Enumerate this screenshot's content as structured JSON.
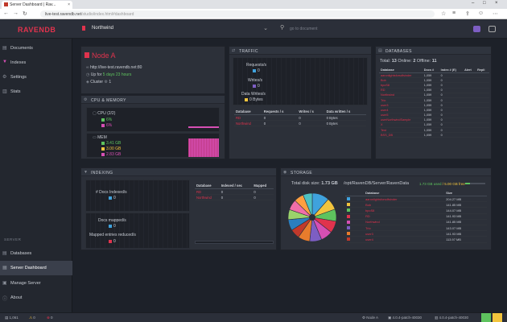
{
  "browser": {
    "tab_title": "Server Dashboard | Rav...",
    "url_host": "live-test.ravendb.net",
    "url_path": "/studio/index.html#dashboard"
  },
  "header": {
    "logo_prefix": "RAVEN",
    "logo_suffix": "DB",
    "database": "Northwind",
    "search_placeholder": "go to document"
  },
  "sidebar": {
    "items": [
      {
        "label": "Documents",
        "icon": "documents-icon"
      },
      {
        "label": "Indexes",
        "icon": "indexes-icon"
      },
      {
        "label": "Settings",
        "icon": "settings-icon"
      },
      {
        "label": "Stats",
        "icon": "stats-icon"
      }
    ],
    "server_label": "SERVER",
    "server_items": [
      {
        "label": "Databases",
        "icon": "databases-icon"
      },
      {
        "label": "Server Dashboard",
        "icon": "dashboard-icon"
      },
      {
        "label": "Manage Server",
        "icon": "manage-server-icon"
      },
      {
        "label": "About",
        "icon": "about-icon"
      }
    ]
  },
  "node": {
    "title": "Node A",
    "url": "http://live-test.ravendb.net:80",
    "uptime_label": "Up for",
    "uptime": "5 days 23 hours",
    "cluster_label": "Cluster",
    "cluster_count": "1"
  },
  "cpu_memory": {
    "title": "CPU & MEMORY",
    "cpu_label": "CPU",
    "cpu_cores": "(2/2)",
    "cpu_total": "6%",
    "cpu_ravendb": "6%",
    "mem_label": "MEM",
    "mem_total": "3.41 GB",
    "mem_used": "3.00 GB",
    "mem_ravendb": "2.83 GB"
  },
  "traffic": {
    "title": "TRAFFIC",
    "requests_label": "Requests/s",
    "requests_value": "0",
    "writes_label": "Writes/s",
    "writes_value": "0",
    "data_writes_label": "Data Writes/s",
    "data_writes_value": "0 Bytes",
    "columns": [
      "Database",
      "Requests / s",
      "Writes / s",
      "Data written / s"
    ],
    "rows": [
      [
        "RD",
        "0",
        "0",
        "0 Bytes"
      ],
      [
        "Northwind",
        "0",
        "0",
        "0 Bytes"
      ]
    ]
  },
  "databases": {
    "title": "DATABASES",
    "total_label": "Total:",
    "total": "13",
    "online_label": "Online:",
    "online": "2",
    "offline_label": "Offline:",
    "offline": "11",
    "columns": [
      "Database",
      "Docs #",
      "Index # (E)",
      "Alert",
      "Repli"
    ],
    "rows": [
      [
        "aaronlightsforsdfsinder",
        "1,059",
        "0",
        "",
        ""
      ],
      [
        "Bob",
        "1,059",
        "0",
        "",
        ""
      ],
      [
        "bpoS8",
        "1,059",
        "0",
        "",
        ""
      ],
      [
        "RD",
        "1,059",
        "0",
        "",
        ""
      ],
      [
        "Northwind",
        "1,059",
        "0",
        "",
        ""
      ],
      [
        "Trio",
        "1,059",
        "0",
        "",
        ""
      ],
      [
        "user3",
        "1,059",
        "0",
        "",
        ""
      ],
      [
        "user4",
        "1,059",
        "0",
        "",
        ""
      ],
      [
        "user5",
        "1,059",
        "0",
        "",
        ""
      ],
      [
        "userNorthwindSample",
        "1,059",
        "0",
        "",
        ""
      ],
      [
        "X",
        "1,059",
        "0",
        "",
        ""
      ],
      [
        "Test",
        "1,059",
        "0",
        "",
        ""
      ],
      [
        "BSS_DB",
        "1,059",
        "0",
        "",
        ""
      ]
    ]
  },
  "indexing": {
    "title": "INDEXING",
    "docs_indexed_label": "# Docs Indexed/s",
    "docs_indexed": "0",
    "docs_mapped_label": "Docs mapped/s",
    "docs_mapped": "0",
    "mapped_reduced_label": "Mapped entries reduced/s",
    "mapped_reduced": "0",
    "columns": [
      "Database",
      "Indexed / sec",
      "Mapped"
    ],
    "rows": [
      [
        "RD",
        "0",
        "0"
      ],
      [
        "Northwind",
        "0",
        "0"
      ]
    ]
  },
  "storage": {
    "title": "STORAGE",
    "total_label": "Total disk size:",
    "total": "1.73 GB",
    "path": "/opt/RavenDB/Server/RavenData",
    "used": "1.73 GB used",
    "free": "/ 5.00 GB free",
    "columns": [
      "Database",
      "Size"
    ],
    "rows": [
      {
        "name": "aaronlightsforsdfsinder",
        "size": "204.27 MB",
        "color": "#3fa2dd"
      },
      {
        "name": "Bob",
        "size": "141.85 MB",
        "color": "#f2c43d"
      },
      {
        "name": "bpoS8",
        "size": "144.07 MB",
        "color": "#5ec35e"
      },
      {
        "name": "RD",
        "size": "141.93 MB",
        "color": "#e0334d"
      },
      {
        "name": "Northwind",
        "size": "141.85 MB",
        "color": "#d64fb4"
      },
      {
        "name": "Trio",
        "size": "143.07 MB",
        "color": "#7d5ec3"
      },
      {
        "name": "user3",
        "size": "141.93 MB",
        "color": "#e87c2c"
      },
      {
        "name": "user4",
        "size": "113.97 MB",
        "color": "#c0392b"
      }
    ],
    "pie": [
      {
        "value": 204.27,
        "color": "#3fa2dd"
      },
      {
        "value": 141.85,
        "color": "#f2c43d"
      },
      {
        "value": 144.07,
        "color": "#5ec35e"
      },
      {
        "value": 141.93,
        "color": "#e0334d"
      },
      {
        "value": 141.85,
        "color": "#d64fb4"
      },
      {
        "value": 143.07,
        "color": "#7d5ec3"
      },
      {
        "value": 141.93,
        "color": "#e87c2c"
      },
      {
        "value": 113.97,
        "color": "#c0392b"
      },
      {
        "value": 130,
        "color": "#2a7fbf"
      },
      {
        "value": 120,
        "color": "#9bd36b"
      },
      {
        "value": 125,
        "color": "#f06ea9"
      },
      {
        "value": 115,
        "color": "#ff9f40"
      },
      {
        "value": 110,
        "color": "#4fc1c1"
      }
    ]
  },
  "footer": {
    "count": "1,061",
    "alerts": "0",
    "warnings": "0",
    "node": "Node A",
    "server_version": "4.0.4-patch-40030",
    "client_version": "4.0.4-patch-40030"
  },
  "colors": {
    "accent": "#e0334d",
    "green": "#5ec35e",
    "blue": "#3fa2dd",
    "pink": "#d64fb4"
  }
}
